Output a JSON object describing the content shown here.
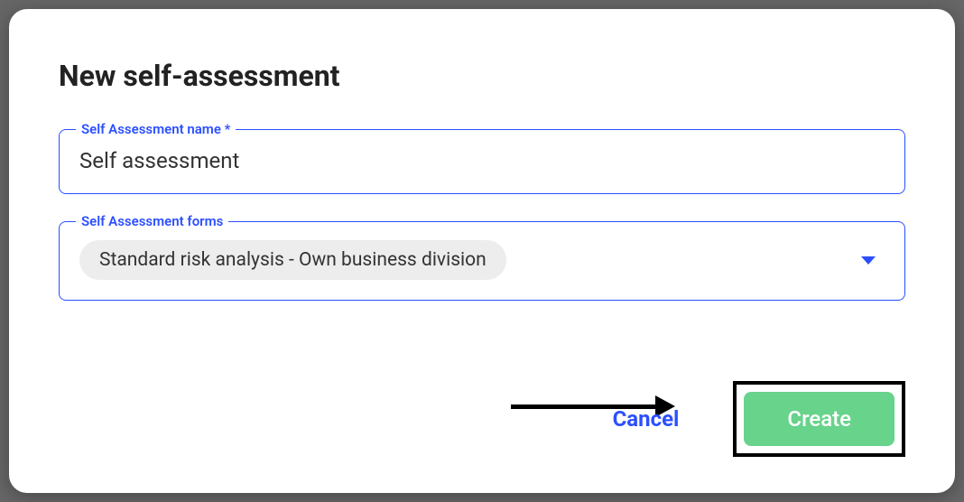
{
  "dialog": {
    "title": "New self-assessment"
  },
  "fields": {
    "name": {
      "label": "Self Assessment name *",
      "value": "Self assessment"
    },
    "forms": {
      "label": "Self Assessment forms",
      "selected": "Standard risk analysis - Own business division"
    }
  },
  "actions": {
    "cancel": "Cancel",
    "create": "Create"
  },
  "colors": {
    "accent": "#2b4fff",
    "success": "#67d38b"
  }
}
